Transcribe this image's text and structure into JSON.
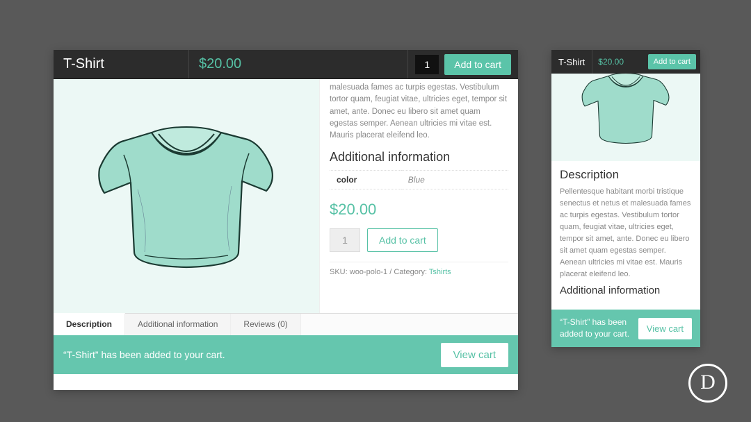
{
  "desktop": {
    "sticky": {
      "title": "T-Shirt",
      "price": "$20.00",
      "qty": "1",
      "add_label": "Add to cart"
    },
    "details": {
      "lorem_partial": "malesuada fames ac turpis egestas. Vestibulum tortor quam, feugiat vitae, ultricies eget, tempor sit amet, ante. Donec eu libero sit amet quam egestas semper. Aenean ultricies mi vitae est. Mauris placerat eleifend leo.",
      "addl_heading": "Additional information",
      "attr_name": "color",
      "attr_value": "Blue",
      "price": "$20.00",
      "qty": "1",
      "add_label": "Add to cart",
      "sku_label": "SKU:",
      "sku_value": "woo-polo-1",
      "cat_label": "Category:",
      "cat_value": "Tshirts"
    },
    "tabs": {
      "t1": "Description",
      "t2": "Additional information",
      "t3": "Reviews (0)"
    },
    "notice": {
      "msg": "“T-Shirt” has been added to your cart.",
      "view_label": "View cart"
    }
  },
  "mobile": {
    "sticky": {
      "title": "T-Shirt",
      "price": "$20.00",
      "add_label": "Add to cart"
    },
    "desc_heading": "Description",
    "lorem": "Pellentesque habitant morbi tristique senectus et netus et malesuada fames ac turpis egestas. Vestibulum tortor quam, feugiat vitae, ultricies eget, tempor sit amet, ante. Donec eu libero sit amet quam egestas semper. Aenean ultricies mi vitae est. Mauris placerat eleifend leo.",
    "addl_heading": "Additional information",
    "notice": {
      "msg": "“T-Shirt” has been added to your cart.",
      "view_label": "View cart"
    }
  },
  "logo": {
    "letter": "D"
  }
}
